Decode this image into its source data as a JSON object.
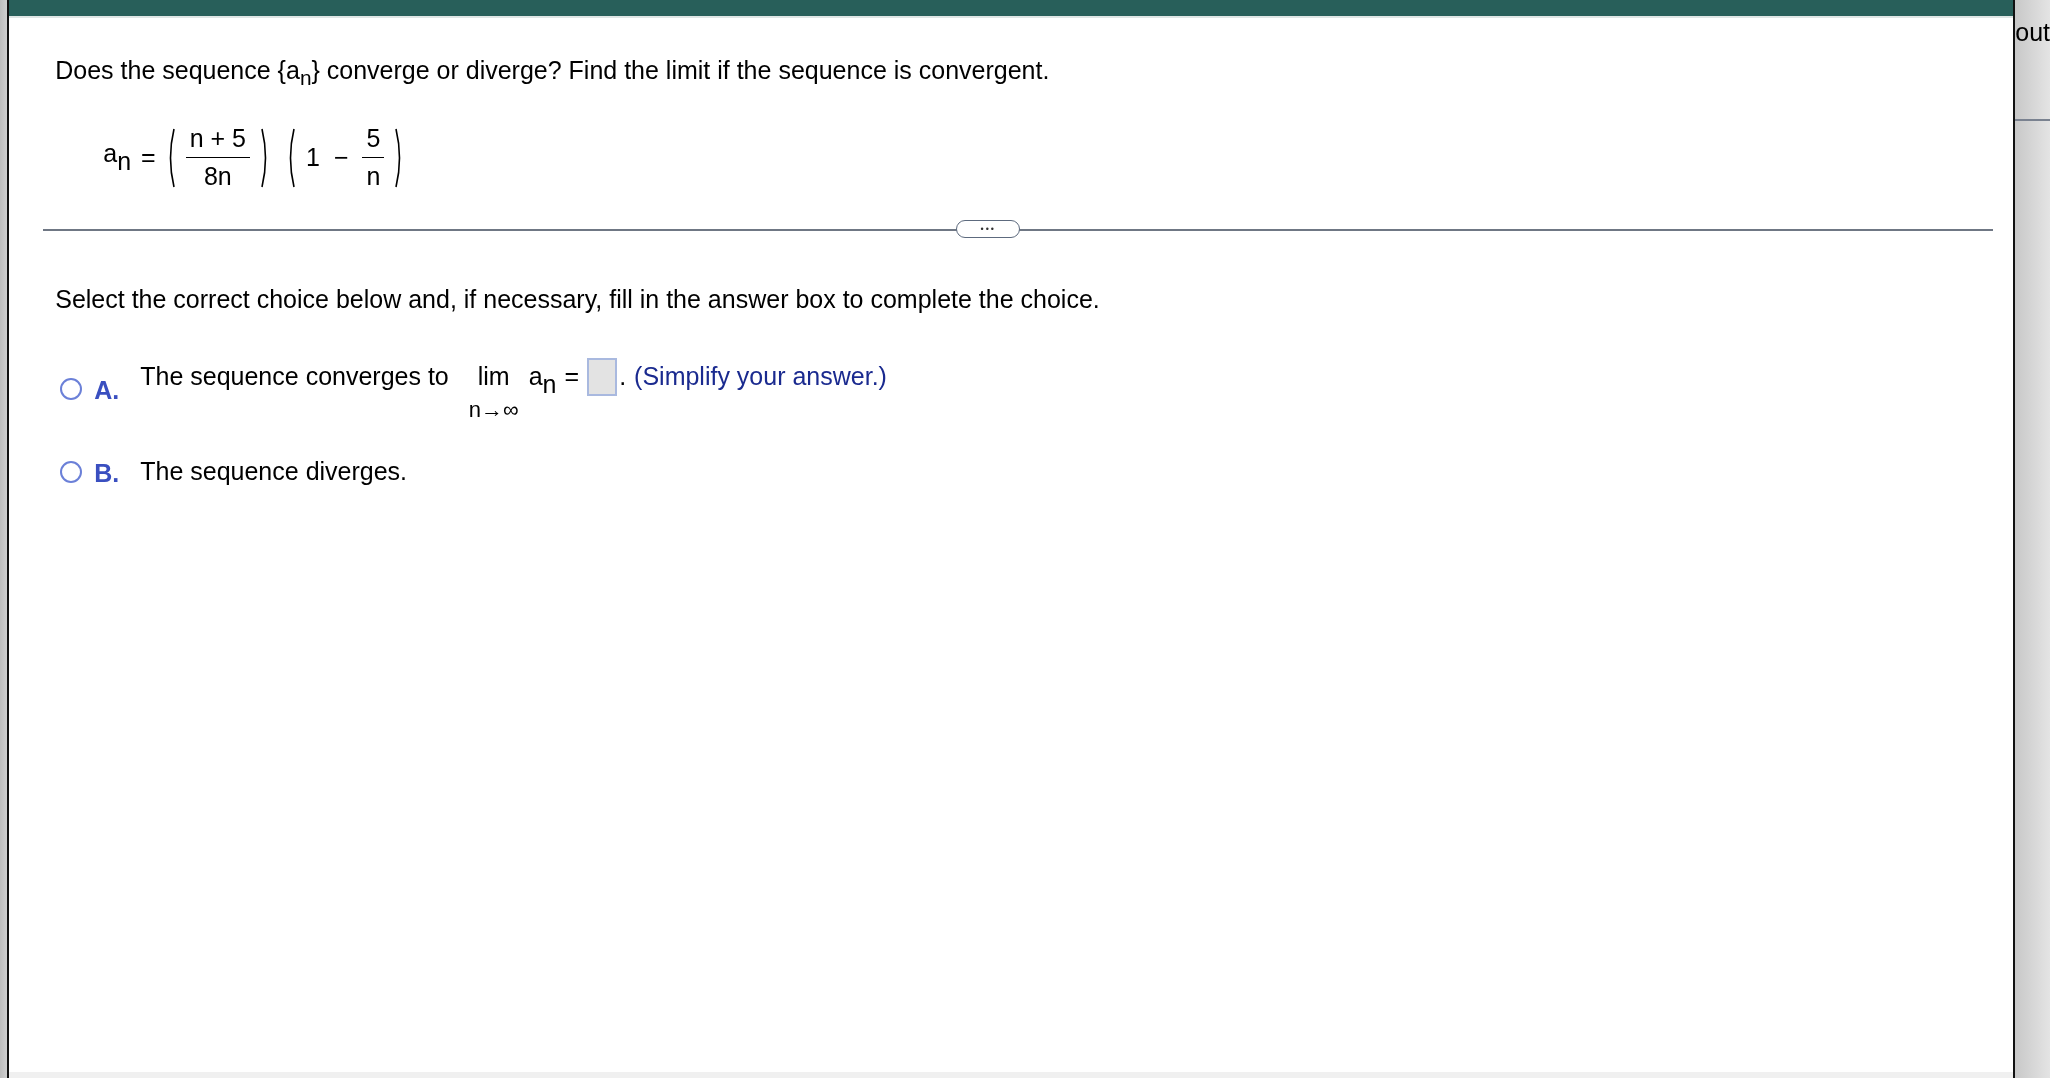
{
  "question": {
    "text": "Does the sequence {a$_{n}$} converge or diverge? Find the limit if the sequence is convergent."
  },
  "formula": {
    "lhs": "a",
    "lhs_sub": "n",
    "eq": "=",
    "fractions": [
      {
        "num": "n + 5",
        "den": "8n"
      }
    ],
    "one": "1",
    "minus": "−",
    "frac2": {
      "num": "5",
      "den": "n"
    }
  },
  "more_button": {
    "label": "•••"
  },
  "instruction": "Select the correct choice below and, if necessary, fill in the answer box to complete the choice.",
  "choices": [
    {
      "letter": "A.",
      "selected": false,
      "kind": "limit",
      "text": "The sequence converges to",
      "lim": "lim",
      "lim_under": "n→∞",
      "var": "a",
      "var_sub": "n",
      "eq": "=",
      "after": ".",
      "hint": "(Simplify your answer.)"
    },
    {
      "letter": "B.",
      "selected": false,
      "kind": "text",
      "text": "The sequence diverges."
    }
  ],
  "right_panel": {
    "text": "out"
  }
}
